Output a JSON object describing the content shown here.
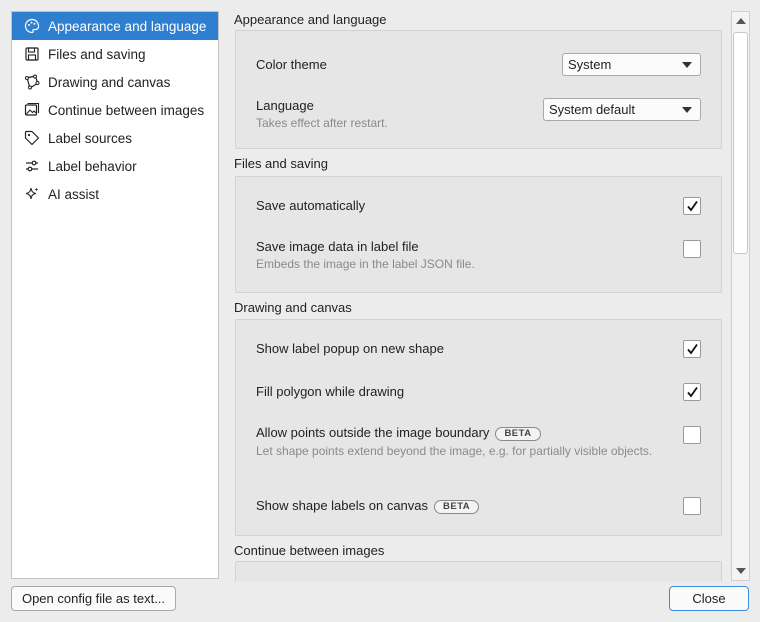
{
  "sidebar": {
    "items": [
      {
        "label": "Appearance and language",
        "icon": "palette-icon",
        "active": true
      },
      {
        "label": "Files and saving",
        "icon": "floppy-disk-icon",
        "active": false
      },
      {
        "label": "Drawing and canvas",
        "icon": "polygon-icon",
        "active": false
      },
      {
        "label": "Continue between images",
        "icon": "images-icon",
        "active": false
      },
      {
        "label": "Label sources",
        "icon": "tag-icon",
        "active": false
      },
      {
        "label": "Label behavior",
        "icon": "sliders-icon",
        "active": false
      },
      {
        "label": "AI assist",
        "icon": "sparkles-icon",
        "active": false
      }
    ]
  },
  "appearance": {
    "title": "Appearance and language",
    "color_theme_label": "Color theme",
    "color_theme_value": "System",
    "language_label": "Language",
    "language_value": "System default",
    "language_hint": "Takes effect after restart."
  },
  "files": {
    "title": "Files and saving",
    "save_auto_label": "Save automatically",
    "save_auto_checked": true,
    "save_image_label": "Save image data in label file",
    "save_image_hint": "Embeds the image in the label JSON file.",
    "save_image_checked": false
  },
  "drawing": {
    "title": "Drawing and canvas",
    "popup_label": "Show label popup on new shape",
    "popup_checked": true,
    "fill_label": "Fill polygon while drawing",
    "fill_checked": true,
    "outside_label": "Allow points outside the image boundary",
    "outside_badge": "BETA",
    "outside_hint": "Let shape points extend beyond the image, e.g. for partially visible objects.",
    "outside_checked": false,
    "labels_label": "Show shape labels on canvas",
    "labels_badge": "BETA",
    "labels_checked": false
  },
  "continue": {
    "title": "Continue between images"
  },
  "buttons": {
    "open_config": "Open config file as text...",
    "close": "Close"
  },
  "colors": {
    "accent": "#2f7fd1",
    "group_bg": "#e6e6e6"
  }
}
